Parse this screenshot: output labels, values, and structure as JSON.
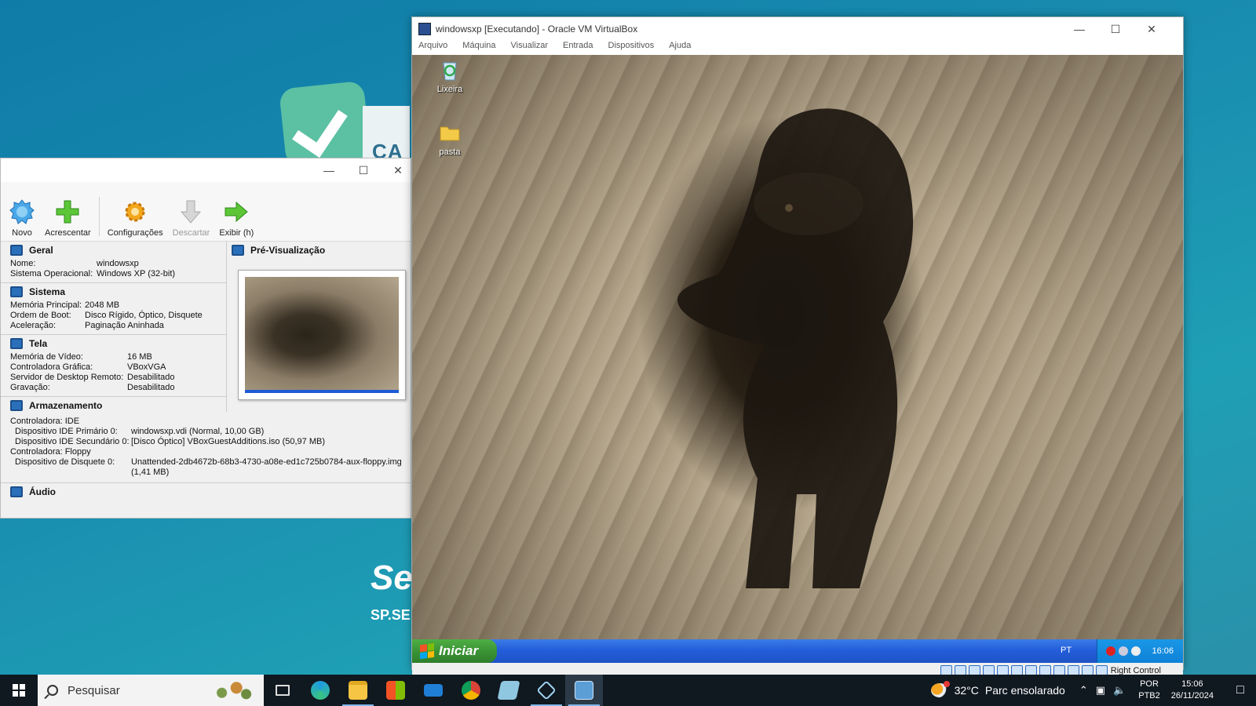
{
  "desktop": {
    "bg_card_text": "CA",
    "bg_brand_big": "Se",
    "bg_brand_small": "SP.SE"
  },
  "manager": {
    "toolbar": {
      "new_label": "Novo",
      "add_label": "Acrescentar",
      "settings_label": "Configurações",
      "discard_label": "Descartar",
      "show_label": "Exibir (h)"
    },
    "general": {
      "title": "Geral",
      "name_key": "Nome:",
      "name_val": "windowsxp",
      "os_key": "Sistema Operacional:",
      "os_val": "Windows XP (32-bit)"
    },
    "system": {
      "title": "Sistema",
      "mem_key": "Memória Principal:",
      "mem_val": "2048 MB",
      "boot_key": "Ordem de Boot:",
      "boot_val": "Disco Rígido, Óptico, Disquete",
      "accel_key": "Aceleração:",
      "accel_val": "Paginação Aninhada"
    },
    "display": {
      "title": "Tela",
      "vram_key": "Memória de Vídeo:",
      "vram_val": "16 MB",
      "ctrl_key": "Controladora Gráfica:",
      "ctrl_val": "VBoxVGA",
      "rdp_key": "Servidor de Desktop Remoto:",
      "rdp_val": "Desabilitado",
      "rec_key": "Gravação:",
      "rec_val": "Desabilitado"
    },
    "preview": {
      "title": "Pré-Visualização"
    },
    "storage": {
      "title": "Armazenamento",
      "ctrl_ide": "Controladora: IDE",
      "ide_primary_key": "Dispositivo IDE Primário 0:",
      "ide_primary_val": "windowsxp.vdi (Normal, 10,00 GB)",
      "ide_secondary_key": "Dispositivo IDE Secundário 0:",
      "ide_secondary_val": "[Disco Óptico] VBoxGuestAdditions.iso (50,97 MB)",
      "ctrl_floppy": "Controladora: Floppy",
      "floppy_key": "Dispositivo de Disquete 0:",
      "floppy_val": "Unattended-2db4672b-68b3-4730-a08e-ed1c725b0784-aux-floppy.img",
      "floppy_size": "(1,41 MB)"
    },
    "audio": {
      "title": "Áudio"
    }
  },
  "vm": {
    "title": "windowsxp [Executando] - Oracle VM VirtualBox",
    "menu": [
      "Arquivo",
      "Máquina",
      "Visualizar",
      "Entrada",
      "Dispositivos",
      "Ajuda"
    ],
    "desktop_icons": {
      "recycle": "Lixeira",
      "folder": "pasta"
    },
    "xp_taskbar": {
      "start": "Iniciar",
      "lang": "PT",
      "time": "16:06"
    },
    "status_host_key": "Right Control"
  },
  "taskbar": {
    "search_placeholder": "Pesquisar",
    "weather_temp": "32°C",
    "weather_text": "Parc ensolarado",
    "lang_line1": "POR",
    "lang_line2": "PTB2",
    "time": "15:06",
    "date": "26/11/2024"
  },
  "colors": {
    "xp_blue": "#245edb",
    "xp_green": "#3a9435",
    "desktop_teal": "#1a8fb0",
    "taskbar": "#101820"
  }
}
